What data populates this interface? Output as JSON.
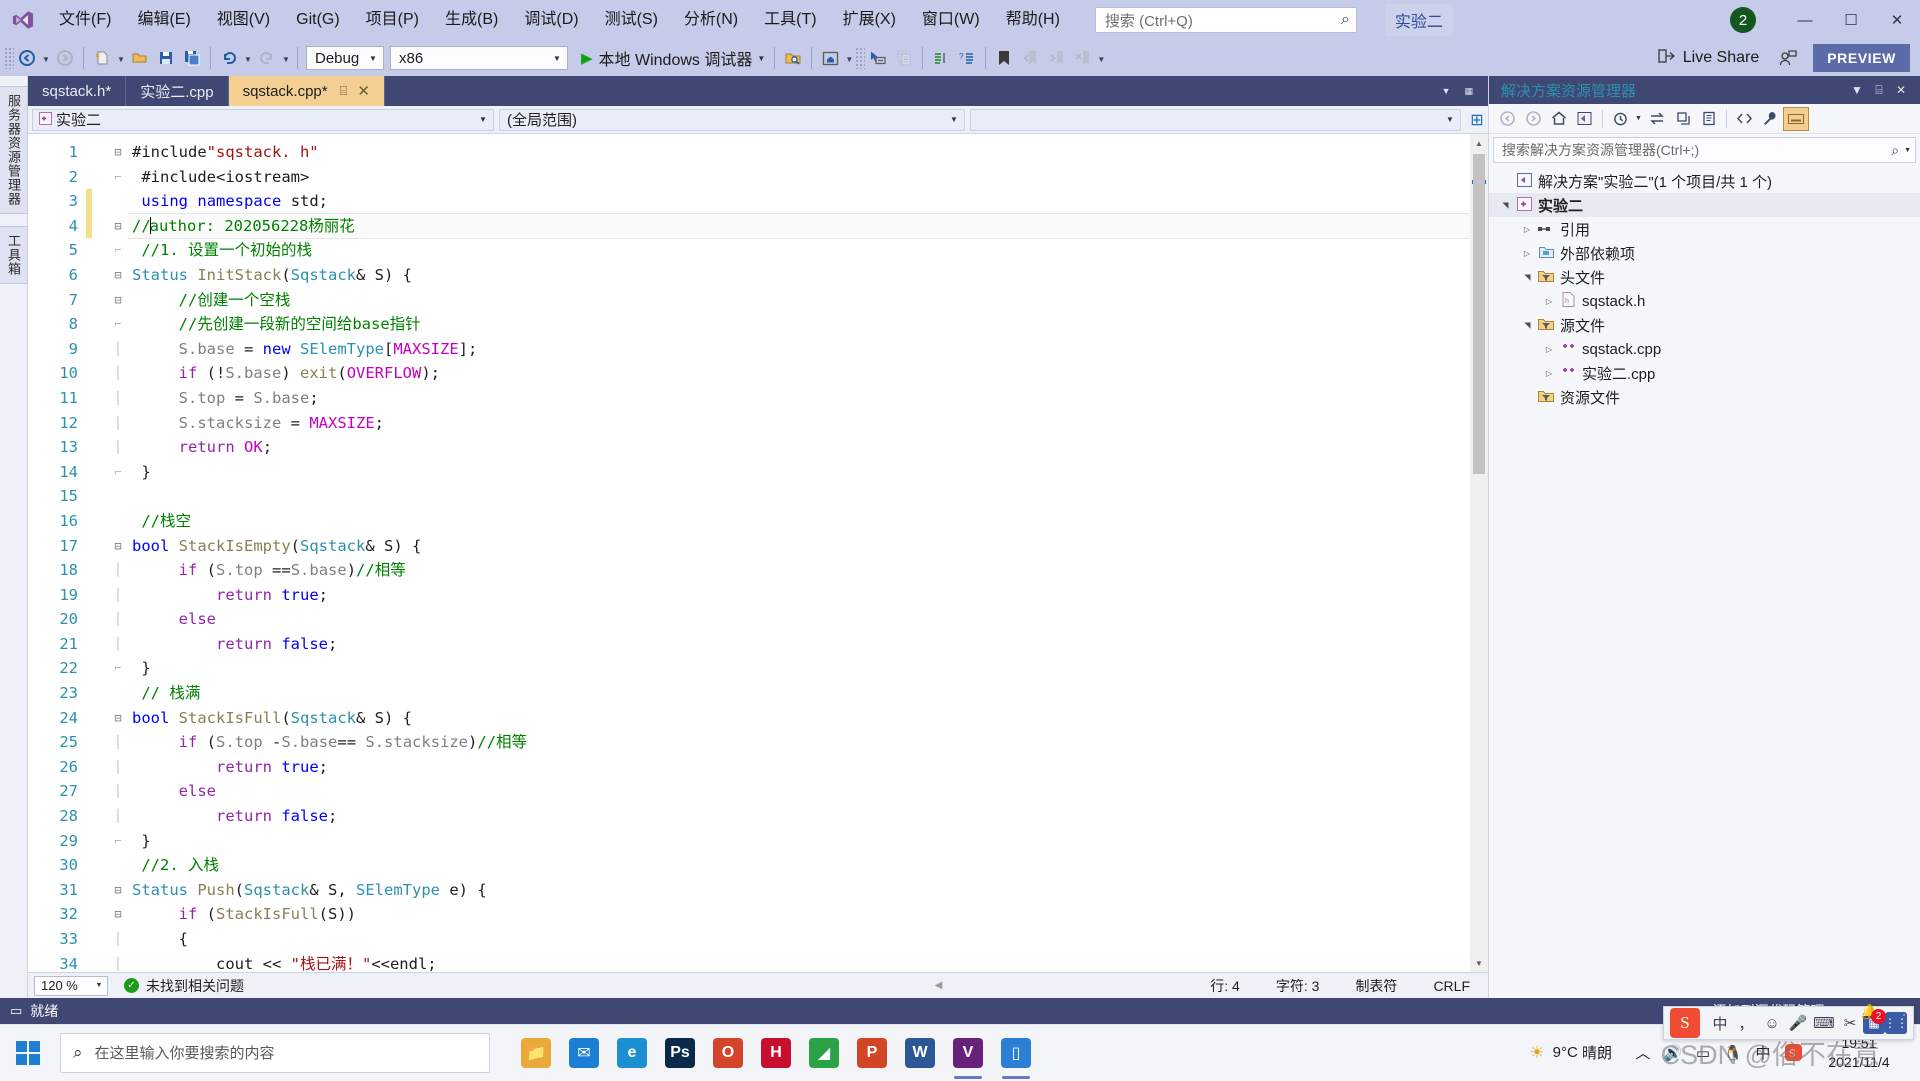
{
  "titlebar": {
    "logo_icon": "visual-studio-logo",
    "menus": [
      "文件(F)",
      "编辑(E)",
      "视图(V)",
      "Git(G)",
      "项目(P)",
      "生成(B)",
      "调试(D)",
      "测试(S)",
      "分析(N)",
      "工具(T)",
      "扩展(X)",
      "窗口(W)",
      "帮助(H)"
    ],
    "search_placeholder": "搜索 (Ctrl+Q)",
    "search_icon": "search-icon",
    "solution_name": "实验二",
    "avatar_text": "2",
    "minimize_icon": "minimize-icon",
    "maximize_icon": "maximize-icon",
    "close_icon": "close-icon",
    "bg_color": "#c5cbe8"
  },
  "toolbar": {
    "nav_back_icon": "navigate-back-icon",
    "nav_fwd_icon": "navigate-forward-icon",
    "new_item_icon": "new-item-icon",
    "open_icon": "open-file-icon",
    "save_icon": "save-icon",
    "save_all_icon": "save-all-icon",
    "undo_icon": "undo-icon",
    "redo_icon": "redo-icon",
    "config": "Debug",
    "platform": "x86",
    "run_label": "本地 Windows 调试器",
    "run_icon": "play-icon",
    "search_folder_icon": "search-in-folder-icon",
    "home_icon": "preview-window-icon",
    "pointer_icon": "select-element-icon",
    "window_icon": "window-icon",
    "copy_icon": "copy-icon",
    "indent_icon": "comment-icon",
    "uncomment_icon": "uncomment-icon",
    "bookmark_icon": "bookmark-icon",
    "bm_prev_icon": "bookmark-prev-icon",
    "bm_next_icon": "bookmark-next-icon",
    "bm_clear_icon": "bookmark-clear-icon",
    "overflow_icon": "toolbar-overflow-icon",
    "live_share_label": "Live Share",
    "live_share_icon": "live-share-icon",
    "feedback_icon": "feedback-icon",
    "preview_badge": "PREVIEW",
    "preview_color": "#5d6aa8"
  },
  "left_rail": {
    "items": [
      "服务器资源管理器",
      "工具箱"
    ]
  },
  "tabs": [
    {
      "label": "sqstack.h*",
      "active": false
    },
    {
      "label": "实验二.cpp",
      "active": false
    },
    {
      "label": "sqstack.cpp*",
      "active": true,
      "pin_icon": "pin-icon",
      "close_icon": "close-tab-icon"
    }
  ],
  "navbar": {
    "project_icon": "cpp-project-icon",
    "project": "实验二",
    "scope": "(全局范围)",
    "member": "",
    "add_icon": "split-view-icon"
  },
  "editor": {
    "cursor_line": 4,
    "changed_lines": [
      3,
      4
    ],
    "lines": [
      {
        "n": 1,
        "fold": "minus",
        "tokens": [
          [
            "pl",
            "#include"
          ],
          [
            "str",
            "\"sqstack. h\""
          ]
        ]
      },
      {
        "n": 2,
        "fold": "bar-end",
        "tokens": [
          [
            "pl",
            " #include"
          ],
          [
            "pl",
            "<iostream>"
          ]
        ]
      },
      {
        "n": 3,
        "fold": "",
        "tokens": [
          [
            "pl",
            " "
          ],
          [
            "k",
            "using"
          ],
          [
            "pl",
            " "
          ],
          [
            "k",
            "namespace"
          ],
          [
            "pl",
            " std;"
          ]
        ]
      },
      {
        "n": 4,
        "fold": "minus",
        "tokens": [
          [
            "cm",
            "//author: 202056228杨丽花"
          ]
        ]
      },
      {
        "n": 5,
        "fold": "bar-end",
        "tokens": [
          [
            "cm",
            " //1. 设置一个初始的栈"
          ]
        ]
      },
      {
        "n": 6,
        "fold": "minus",
        "tokens": [
          [
            "t",
            "Status"
          ],
          [
            "pl",
            " "
          ],
          [
            "fn",
            "InitStack"
          ],
          [
            "pl",
            "("
          ],
          [
            "t",
            "Sqstack"
          ],
          [
            "pl",
            "& S) {"
          ]
        ]
      },
      {
        "n": 7,
        "fold": "minus2",
        "tokens": [
          [
            "cm",
            "     //创建一个空栈"
          ]
        ]
      },
      {
        "n": 8,
        "fold": "bar-end2",
        "tokens": [
          [
            "cm",
            "     //先创建一段新的空间给base指针"
          ]
        ]
      },
      {
        "n": 9,
        "fold": "bar",
        "tokens": [
          [
            "vr",
            "     S."
          ],
          [
            "vr",
            "base"
          ],
          [
            "pl",
            " = "
          ],
          [
            "k",
            "new"
          ],
          [
            "pl",
            " "
          ],
          [
            "t",
            "SElemType"
          ],
          [
            "pl",
            "["
          ],
          [
            "mac",
            "MAXSIZE"
          ],
          [
            "pl",
            "];"
          ]
        ]
      },
      {
        "n": 10,
        "fold": "bar",
        "tokens": [
          [
            "pl",
            "     "
          ],
          [
            "kv",
            "if"
          ],
          [
            "pl",
            " (!"
          ],
          [
            "vr",
            "S."
          ],
          [
            "vr",
            "base"
          ],
          [
            "pl",
            ") "
          ],
          [
            "fn",
            "exit"
          ],
          [
            "pl",
            "("
          ],
          [
            "mac",
            "OVERFLOW"
          ],
          [
            "pl",
            ");"
          ]
        ]
      },
      {
        "n": 11,
        "fold": "bar",
        "tokens": [
          [
            "vr",
            "     S."
          ],
          [
            "vr",
            "top"
          ],
          [
            "pl",
            " = "
          ],
          [
            "vr",
            "S."
          ],
          [
            "vr",
            "base"
          ],
          [
            "pl",
            ";"
          ]
        ]
      },
      {
        "n": 12,
        "fold": "bar",
        "tokens": [
          [
            "vr",
            "     S."
          ],
          [
            "vr",
            "stacksize"
          ],
          [
            "pl",
            " = "
          ],
          [
            "mac",
            "MAXSIZE"
          ],
          [
            "pl",
            ";"
          ]
        ]
      },
      {
        "n": 13,
        "fold": "bar",
        "tokens": [
          [
            "pl",
            "     "
          ],
          [
            "kv",
            "return"
          ],
          [
            "pl",
            " "
          ],
          [
            "mac",
            "OK"
          ],
          [
            "pl",
            ";"
          ]
        ]
      },
      {
        "n": 14,
        "fold": "end",
        "tokens": [
          [
            "pl",
            " }"
          ]
        ]
      },
      {
        "n": 15,
        "fold": "",
        "tokens": [
          [
            "pl",
            ""
          ]
        ]
      },
      {
        "n": 16,
        "fold": "",
        "tokens": [
          [
            "cm",
            " //栈空"
          ]
        ]
      },
      {
        "n": 17,
        "fold": "minus",
        "tokens": [
          [
            "k",
            "bool"
          ],
          [
            "pl",
            " "
          ],
          [
            "fn",
            "StackIsEmpty"
          ],
          [
            "pl",
            "("
          ],
          [
            "t",
            "Sqstack"
          ],
          [
            "pl",
            "& S) {"
          ]
        ]
      },
      {
        "n": 18,
        "fold": "bar2",
        "tokens": [
          [
            "pl",
            "     "
          ],
          [
            "kv",
            "if"
          ],
          [
            "pl",
            " ("
          ],
          [
            "vr",
            "S."
          ],
          [
            "vr",
            "top"
          ],
          [
            "pl",
            " =="
          ],
          [
            "vr",
            "S."
          ],
          [
            "vr",
            "base"
          ],
          [
            "pl",
            ")"
          ],
          [
            "cm",
            "//相等"
          ]
        ]
      },
      {
        "n": 19,
        "fold": "bar2",
        "tokens": [
          [
            "pl",
            "         "
          ],
          [
            "kv",
            "return"
          ],
          [
            "pl",
            " "
          ],
          [
            "k",
            "true"
          ],
          [
            "pl",
            ";"
          ]
        ]
      },
      {
        "n": 20,
        "fold": "bar2",
        "tokens": [
          [
            "pl",
            "     "
          ],
          [
            "kv",
            "else"
          ]
        ]
      },
      {
        "n": 21,
        "fold": "bar2",
        "tokens": [
          [
            "pl",
            "         "
          ],
          [
            "kv",
            "return"
          ],
          [
            "pl",
            " "
          ],
          [
            "k",
            "false"
          ],
          [
            "pl",
            ";"
          ]
        ]
      },
      {
        "n": 22,
        "fold": "end",
        "tokens": [
          [
            "pl",
            " }"
          ]
        ]
      },
      {
        "n": 23,
        "fold": "",
        "tokens": [
          [
            "cm",
            " // 栈满"
          ]
        ]
      },
      {
        "n": 24,
        "fold": "minus",
        "tokens": [
          [
            "k",
            "bool"
          ],
          [
            "pl",
            " "
          ],
          [
            "fn",
            "StackIsFull"
          ],
          [
            "pl",
            "("
          ],
          [
            "t",
            "Sqstack"
          ],
          [
            "pl",
            "& S) {"
          ]
        ]
      },
      {
        "n": 25,
        "fold": "bar2",
        "tokens": [
          [
            "pl",
            "     "
          ],
          [
            "kv",
            "if"
          ],
          [
            "pl",
            " ("
          ],
          [
            "vr",
            "S."
          ],
          [
            "vr",
            "top"
          ],
          [
            "pl",
            " -"
          ],
          [
            "vr",
            "S."
          ],
          [
            "vr",
            "base"
          ],
          [
            "pl",
            "== "
          ],
          [
            "vr",
            "S."
          ],
          [
            "vr",
            "stacksize"
          ],
          [
            "pl",
            ")"
          ],
          [
            "cm",
            "//相等"
          ]
        ]
      },
      {
        "n": 26,
        "fold": "bar2",
        "tokens": [
          [
            "pl",
            "         "
          ],
          [
            "kv",
            "return"
          ],
          [
            "pl",
            " "
          ],
          [
            "k",
            "true"
          ],
          [
            "pl",
            ";"
          ]
        ]
      },
      {
        "n": 27,
        "fold": "bar2",
        "tokens": [
          [
            "pl",
            "     "
          ],
          [
            "kv",
            "else"
          ]
        ]
      },
      {
        "n": 28,
        "fold": "bar2",
        "tokens": [
          [
            "pl",
            "         "
          ],
          [
            "kv",
            "return"
          ],
          [
            "pl",
            " "
          ],
          [
            "k",
            "false"
          ],
          [
            "pl",
            ";"
          ]
        ]
      },
      {
        "n": 29,
        "fold": "end",
        "tokens": [
          [
            "pl",
            " }"
          ]
        ]
      },
      {
        "n": 30,
        "fold": "",
        "tokens": [
          [
            "cm",
            " //2. 入栈"
          ]
        ]
      },
      {
        "n": 31,
        "fold": "minus",
        "tokens": [
          [
            "t",
            "Status"
          ],
          [
            "pl",
            " "
          ],
          [
            "fn",
            "Push"
          ],
          [
            "pl",
            "("
          ],
          [
            "t",
            "Sqstack"
          ],
          [
            "pl",
            "& S, "
          ],
          [
            "t",
            "SElemType"
          ],
          [
            "pl",
            " e) {"
          ]
        ]
      },
      {
        "n": 32,
        "fold": "minus2",
        "tokens": [
          [
            "pl",
            "     "
          ],
          [
            "kv",
            "if"
          ],
          [
            "pl",
            " ("
          ],
          [
            "fn",
            "StackIsFull"
          ],
          [
            "pl",
            "(S))"
          ]
        ]
      },
      {
        "n": 33,
        "fold": "bar2",
        "tokens": [
          [
            "pl",
            "     {"
          ]
        ]
      },
      {
        "n": 34,
        "fold": "bar3",
        "tokens": [
          [
            "pl",
            "         cout << "
          ],
          [
            "str",
            "\"栈已满！\""
          ],
          [
            "pl",
            "<<endl;"
          ]
        ]
      }
    ],
    "scroll_down_icon": "scroll-down-icon",
    "scroll_up_icon": "scroll-up-icon"
  },
  "editor_status": {
    "zoom": "120 %",
    "error_text": "未找到相关问题",
    "ok_icon": "check-circle-icon",
    "arrow_icon": "scroll-left-icon",
    "line_label": "行: 4",
    "col_label": "字符: 3",
    "tab_label": "制表符",
    "eol_label": "CRLF"
  },
  "solution_explorer": {
    "title": "解决方案资源管理器",
    "dropdown_icon": "chevron-down-icon",
    "pin_icon": "pin-icon",
    "close_icon": "close-icon",
    "tools": [
      {
        "icon": "back-arrow-icon",
        "name": "nav-back",
        "state": "disabled"
      },
      {
        "icon": "forward-arrow-icon",
        "name": "nav-forward",
        "state": "disabled"
      },
      {
        "icon": "home-icon",
        "name": "home"
      },
      {
        "icon": "solution-icon",
        "name": "solution"
      },
      {
        "icon": "pending-changes-icon",
        "name": "pending-changes",
        "caret": true
      },
      {
        "icon": "sync-icon",
        "name": "sync-with-active-document"
      },
      {
        "icon": "collapse-all-icon",
        "name": "collapse-all"
      },
      {
        "icon": "properties-icon",
        "name": "properties"
      },
      {
        "icon": "show-all-files-icon",
        "name": "show-all-files"
      },
      {
        "icon": "wrench-icon",
        "name": "settings"
      },
      {
        "icon": "preview-selected-icon",
        "name": "preview-selected-items",
        "state": "selected"
      }
    ],
    "search_placeholder": "搜索解决方案资源管理器(Ctrl+;)",
    "search_icon": "search-icon",
    "search_dropdown_icon": "chevron-down-icon",
    "tree": [
      {
        "depth": 0,
        "exp": "",
        "icon": "solution-icon",
        "label": "解决方案\"实验二\"(1 个项目/共 1 个)",
        "bold": false,
        "selected": false
      },
      {
        "depth": 0,
        "exp": "open",
        "icon": "cpp-project-icon",
        "label": "实验二",
        "bold": true,
        "selected": true
      },
      {
        "depth": 1,
        "exp": "closed",
        "icon": "references-icon",
        "label": "引用",
        "bold": false,
        "selected": false
      },
      {
        "depth": 1,
        "exp": "closed",
        "icon": "external-deps-icon",
        "label": "外部依赖项",
        "bold": false,
        "selected": false
      },
      {
        "depth": 1,
        "exp": "open",
        "icon": "filter-folder-icon",
        "label": "头文件",
        "bold": false,
        "selected": false
      },
      {
        "depth": 2,
        "exp": "closed",
        "icon": "header-file-icon",
        "label": "sqstack.h",
        "bold": false,
        "selected": false
      },
      {
        "depth": 1,
        "exp": "open",
        "icon": "filter-folder-icon",
        "label": "源文件",
        "bold": false,
        "selected": false
      },
      {
        "depth": 2,
        "exp": "closed",
        "icon": "cpp-file-icon",
        "label": "sqstack.cpp",
        "bold": false,
        "selected": false
      },
      {
        "depth": 2,
        "exp": "closed",
        "icon": "cpp-file-icon",
        "label": "实验二.cpp",
        "bold": false,
        "selected": false
      },
      {
        "depth": 1,
        "exp": "",
        "icon": "filter-folder-icon",
        "label": "资源文件",
        "bold": false,
        "selected": false
      }
    ]
  },
  "ime_bar": {
    "logo_icon": "sogou-pinyin-icon",
    "mode_label": "中",
    "items": [
      "comma-icon",
      "emoji-icon",
      "microphone-icon",
      "keyboard-icon",
      "screenshot-icon",
      "toolbox-icon",
      "menu-icon"
    ]
  },
  "vs_status": {
    "ready": "就绪",
    "ready_icon": "ready-icon",
    "source_control": "添加到源代码管理",
    "source_control_icon": "up-arrow-icon",
    "source_control_caret": "chevron-up-icon",
    "notification_icon": "bell-icon",
    "notification_count": "2",
    "bg_color": "#3f4872"
  },
  "taskbar": {
    "start_icon": "windows-start-icon",
    "search_placeholder": "在这里输入你要搜索的内容",
    "search_icon": "search-icon",
    "apps": [
      {
        "name": "file-explorer",
        "glyph": "📁",
        "color": "#e8a93a",
        "active": false
      },
      {
        "name": "mail",
        "glyph": "✉",
        "color": "#1a7fd4",
        "active": false
      },
      {
        "name": "edge-browser",
        "glyph": "e",
        "color": "#1a8fd1",
        "active": false
      },
      {
        "name": "photoshop",
        "glyph": "Ps",
        "color": "#0b2a4a",
        "active": false
      },
      {
        "name": "office",
        "glyph": "O",
        "color": "#d4442a",
        "active": false
      },
      {
        "name": "huawei-share",
        "glyph": "H",
        "color": "#c8102e",
        "active": false
      },
      {
        "name": "wechat-dev",
        "glyph": "◢",
        "color": "#2ba245",
        "active": false
      },
      {
        "name": "powerpoint",
        "glyph": "P",
        "color": "#d24625",
        "active": false
      },
      {
        "name": "word",
        "glyph": "W",
        "color": "#2b5797",
        "active": false
      },
      {
        "name": "visual-studio",
        "glyph": "V",
        "color": "#68217a",
        "active": true
      },
      {
        "name": "window-app",
        "glyph": "▯",
        "color": "#2b7fd4",
        "active": true
      }
    ],
    "weather_temp": "9°C",
    "weather_text": "晴朗",
    "weather_icon": "sun-icon",
    "tray_icons": [
      "chevron-up-icon",
      "volume-icon",
      "battery-icon",
      "qq-icon",
      "ime-chinese-icon",
      "sogou-icon"
    ],
    "clock_time": "19:51",
    "clock_date": "2021/11/4"
  },
  "watermark": "CSDN @俗不在意"
}
